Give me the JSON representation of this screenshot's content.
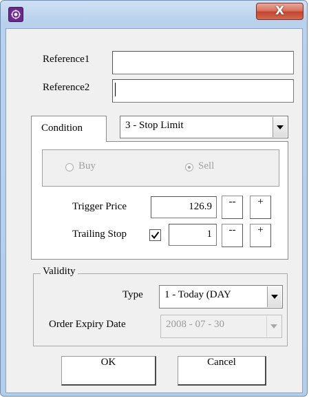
{
  "window": {
    "app_icon": "purple-flower-icon",
    "close_icon": "close-icon",
    "close_glyph": "X"
  },
  "references": {
    "ref1_label": "Reference1",
    "ref1_value": "",
    "ref2_label": "Reference2",
    "ref2_value": ""
  },
  "condition": {
    "tab_label": "Condition",
    "selected": "3 - Stop Limit"
  },
  "side": {
    "buy_label": "Buy",
    "sell_label": "Sell",
    "selected": "Sell"
  },
  "trigger": {
    "label": "Trigger Price",
    "value": "126.9",
    "dec_label": "--",
    "inc_label": "+"
  },
  "trailing": {
    "label": "Trailing Stop",
    "checked": true,
    "value": "1",
    "dec_label": "--",
    "inc_label": "+"
  },
  "validity": {
    "title": "Validity",
    "type_label": "Type",
    "type_value": "1 - Today (DAY",
    "expiry_label": "Order Expiry Date",
    "expiry_value": "2008 - 07 - 30"
  },
  "buttons": {
    "ok": "OK",
    "cancel": "Cancel"
  },
  "colors": {
    "frame": "#b9d1ec",
    "close_button": "#c6452f",
    "app_icon": "#6a2a8a"
  }
}
